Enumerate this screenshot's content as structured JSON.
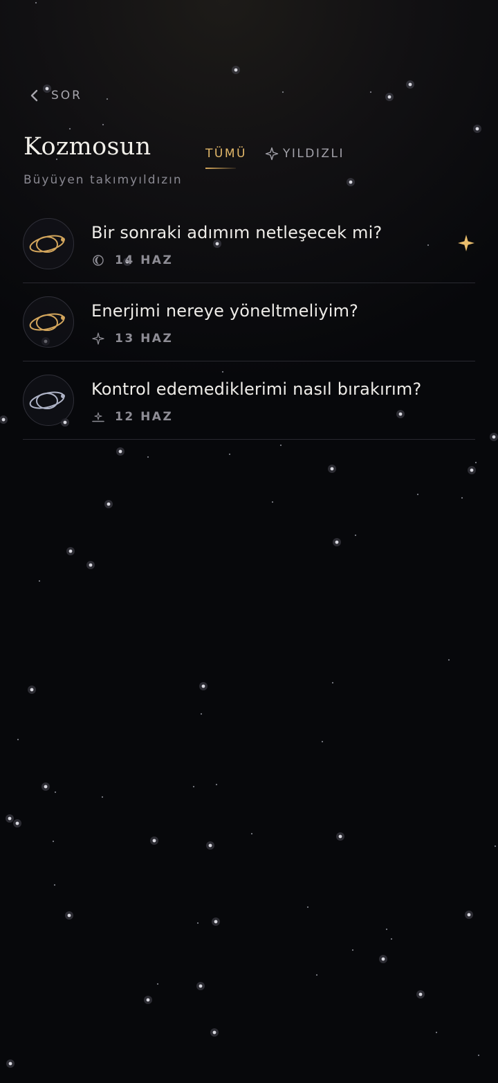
{
  "nav": {
    "back_label": "SOR"
  },
  "header": {
    "title": "Kozmosun",
    "subtitle": "Büyüyen takımyıldızın"
  },
  "tabs": [
    {
      "label": "TÜMÜ",
      "active": true
    },
    {
      "label": "YILDIZLI",
      "active": false,
      "icon": "star-outline-icon"
    }
  ],
  "questions": [
    {
      "text": "Bir sonraki adımım netleşecek mi?",
      "date": "14 HAZ",
      "planet_color": "#d2a55c",
      "meta_icon": "moon-icon",
      "starred": true
    },
    {
      "text": "Enerjimi nereye yöneltmeliyim?",
      "date": "13 HAZ",
      "planet_color": "#d2a55c",
      "meta_icon": "sparkle-icon",
      "starred": false
    },
    {
      "text": "Kontrol edemediklerimi nasıl bırakırım?",
      "date": "12 HAZ",
      "planet_color": "#aeb3c6",
      "meta_icon": "sunrise-icon",
      "starred": false
    }
  ],
  "colors": {
    "accent_gold": "#e4b96a",
    "background": "#07080b",
    "divider": "#2a2a31"
  }
}
